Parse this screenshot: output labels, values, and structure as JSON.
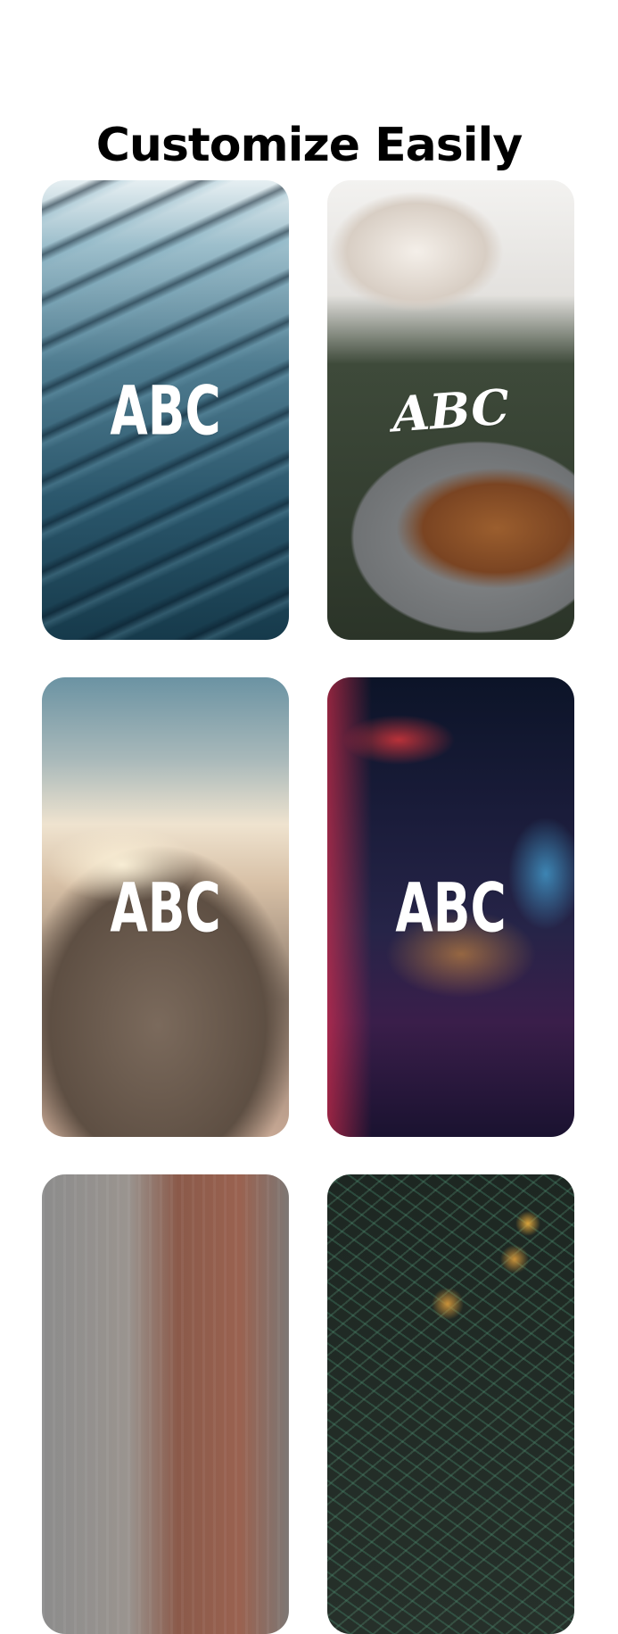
{
  "header": {
    "title": "Customize Easily"
  },
  "cards": [
    {
      "label": "ABC",
      "background": "sand-dunes-photo"
    },
    {
      "label": "ABC",
      "background": "coffee-croissant-photo"
    },
    {
      "label": "ABC",
      "background": "person-on-cliff-photo"
    },
    {
      "label": "ABC",
      "background": "neon-city-street-photo"
    },
    {
      "label": "",
      "background": "rainy-window-building-photo"
    },
    {
      "label": "",
      "background": "pine-branches-photo"
    }
  ],
  "colors": {
    "page_background": "#ffffff",
    "title": "#000000",
    "card_label": "#ffffff"
  }
}
